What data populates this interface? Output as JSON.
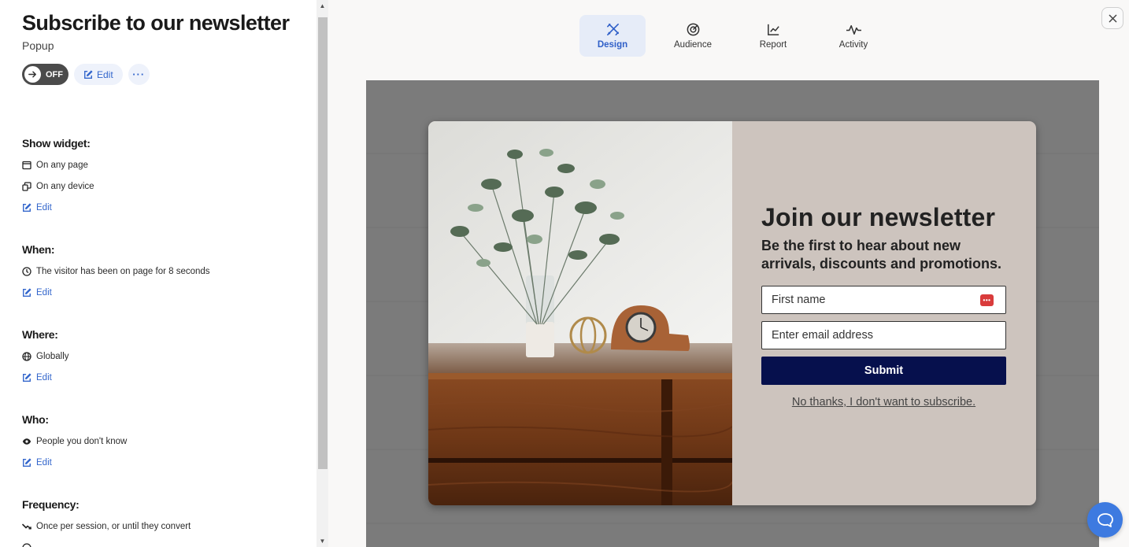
{
  "sidebar": {
    "title": "Subscribe to our newsletter",
    "subtitle": "Popup",
    "toggle_label": "OFF",
    "edit_label": "Edit",
    "more_label": "···",
    "sections": {
      "show_widget": {
        "heading": "Show widget:",
        "rows": [
          "On any page",
          "On any device"
        ],
        "edit": "Edit"
      },
      "when": {
        "heading": "When:",
        "rows": [
          "The visitor has been on page for 8 seconds"
        ],
        "edit": "Edit"
      },
      "where": {
        "heading": "Where:",
        "rows": [
          "Globally"
        ],
        "edit": "Edit"
      },
      "who": {
        "heading": "Who:",
        "rows": [
          "People you don't know"
        ],
        "edit": "Edit"
      },
      "frequency": {
        "heading": "Frequency:",
        "rows": [
          "Once per session, or until they convert"
        ]
      }
    }
  },
  "tabs": [
    {
      "label": "Design",
      "icon": "design-icon",
      "active": true
    },
    {
      "label": "Audience",
      "icon": "target-icon",
      "active": false
    },
    {
      "label": "Report",
      "icon": "chart-icon",
      "active": false
    },
    {
      "label": "Activity",
      "icon": "activity-icon",
      "active": false
    }
  ],
  "popup": {
    "title": "Join our newsletter",
    "subtitle": "Be the first to hear about new arrivals, discounts and promotions.",
    "first_name_placeholder": "First name",
    "email_placeholder": "Enter email address",
    "submit_label": "Submit",
    "decline_label": "No thanks, I don't want to subscribe."
  },
  "colors": {
    "accent": "#3366cc",
    "submit_bg": "#06104d",
    "popup_bg": "#cdc4be",
    "chat_bubble": "#3d7ae0"
  }
}
